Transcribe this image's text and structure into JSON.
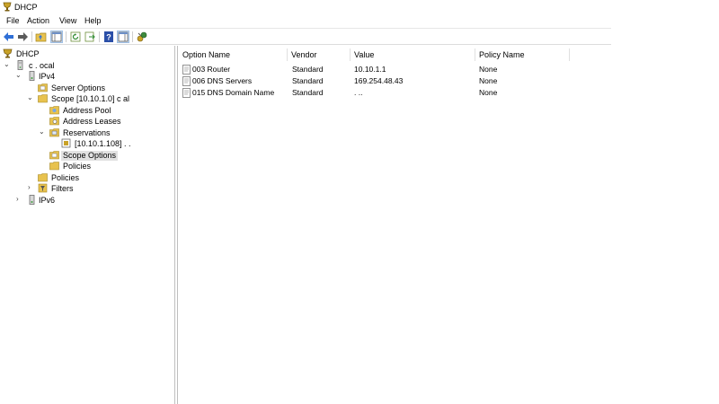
{
  "window": {
    "title": "DHCP"
  },
  "menu": [
    "File",
    "Action",
    "View",
    "Help"
  ],
  "toolbar": {
    "icons": [
      "back-arrow-icon",
      "forward-arrow-icon",
      "up-folder-icon",
      "show-hide-tree-icon",
      "refresh-icon",
      "export-list-icon",
      "help-icon",
      "show-hide-action-pane-icon",
      "dhcp-manage-icon"
    ]
  },
  "tree": {
    "root": "DHCP",
    "server": "c        .       ocal",
    "ipv4": "IPv4",
    "server_options": "Server Options",
    "scope": "Scope [10.10.1.0] c                     al",
    "address_pool": "Address Pool",
    "address_leases": "Address Leases",
    "reservations": "Reservations",
    "reservation_item": "[10.10.1.108] .     .",
    "scope_options": "Scope Options",
    "scope_policies": "Policies",
    "policies": "Policies",
    "filters": "Filters",
    "ipv6": "IPv6"
  },
  "list": {
    "columns": [
      "Option Name",
      "Vendor",
      "Value",
      "Policy Name"
    ],
    "rows": [
      {
        "option": "003 Router",
        "vendor": "Standard",
        "value": "10.10.1.1",
        "policy": "None"
      },
      {
        "option": "006 DNS Servers",
        "vendor": "Standard",
        "value": "169.254.48.43",
        "policy": "None"
      },
      {
        "option": "015 DNS Domain Name",
        "vendor": "Standard",
        "value": "               .         ..",
        "policy": "None"
      }
    ]
  }
}
